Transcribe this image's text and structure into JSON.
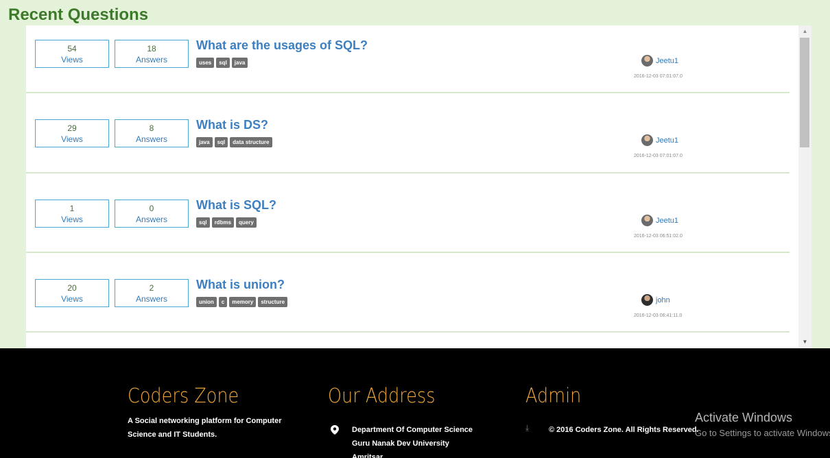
{
  "heading": "Recent Questions",
  "stat_labels": {
    "views": "Views",
    "answers": "Answers"
  },
  "questions": [
    {
      "views": "54",
      "answers": "18",
      "title": "What are the usages of SQL?",
      "tags": [
        "uses",
        "sql",
        "java"
      ],
      "author": "Jeetu1",
      "date": "2016-12-03 07:01:07.0"
    },
    {
      "views": "29",
      "answers": "8",
      "title": "What is DS?",
      "tags": [
        "java",
        "sql",
        "data structure"
      ],
      "author": "Jeetu1",
      "date": "2016-12-03 07:01:07.0"
    },
    {
      "views": "1",
      "answers": "0",
      "title": "What is SQL?",
      "tags": [
        "sql",
        "rdbms",
        "query"
      ],
      "author": "Jeetu1",
      "date": "2016-12-03 06:51:02.0"
    },
    {
      "views": "20",
      "answers": "2",
      "title": "What is union?",
      "tags": [
        "union",
        "c",
        "memory",
        "structure"
      ],
      "author": "john",
      "date": "2016-12-03 06:41:11.0"
    }
  ],
  "footer": {
    "about": {
      "title": "Coders Zone",
      "text_line1": "A Social networking platform for Computer",
      "text_line2": "Science and IT Students."
    },
    "address": {
      "title": "Our Address",
      "line1": "Department Of Computer Science",
      "line2": "Guru Nanak Dev University",
      "line3": "Amritsar"
    },
    "admin": {
      "title": "Admin",
      "copyright": "© 2016 Coders Zone. All Rights Reserved."
    }
  },
  "watermark": {
    "title": "Activate Windows",
    "subtitle": "Go to Settings to activate Windows."
  },
  "icons": {
    "pin": "map-pin-icon",
    "download": "download-icon",
    "avatar": "user-avatar-icon"
  },
  "colors": {
    "accent": "#f0a63a",
    "link": "#3d7fc1",
    "heading": "#3c7a2a",
    "background": "#e3f2d9"
  }
}
